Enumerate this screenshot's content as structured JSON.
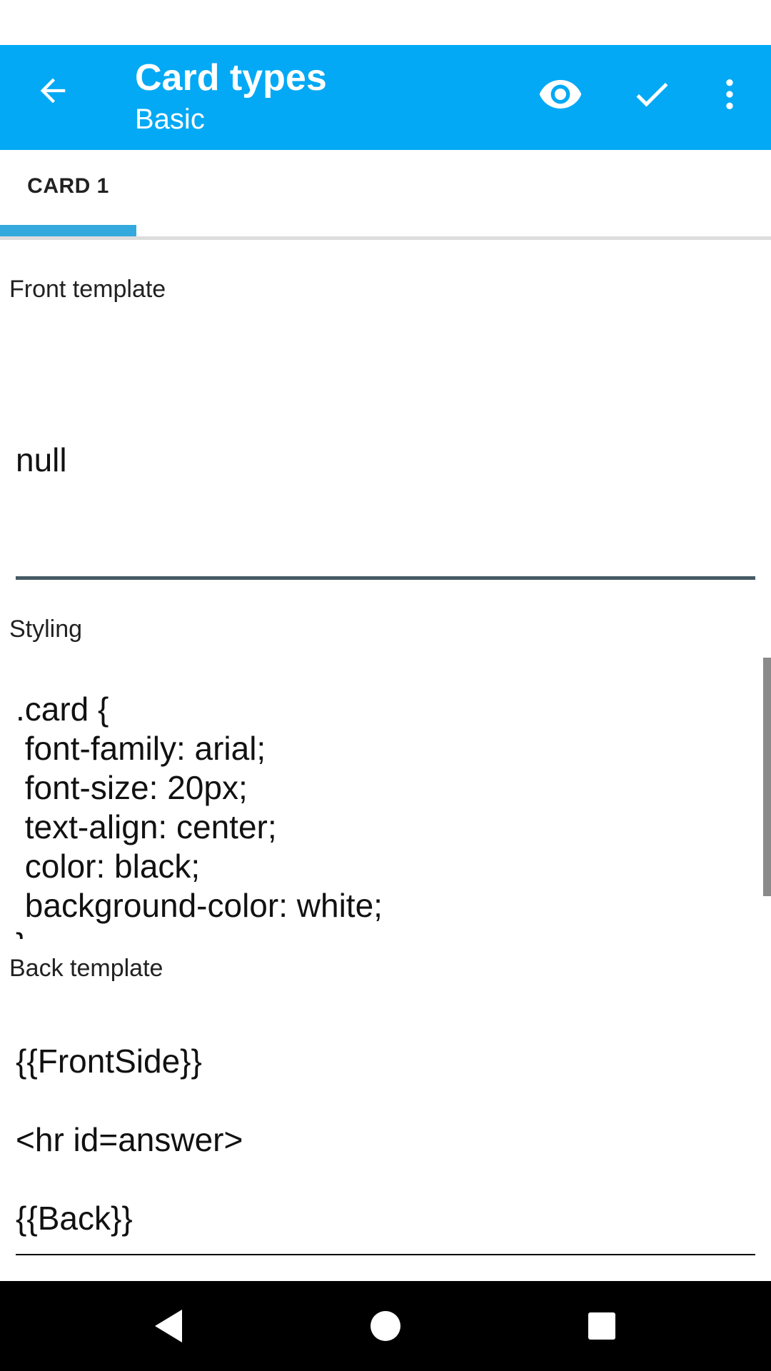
{
  "app_bar": {
    "title": "Card types",
    "subtitle": "Basic",
    "background_color": "#03a9f4",
    "icons": {
      "back": "arrow-left-icon",
      "preview": "eye-icon",
      "done": "check-icon",
      "more": "more-vertical-icon"
    }
  },
  "tabs": [
    {
      "label": "CARD 1",
      "selected": true
    }
  ],
  "front_template": {
    "label": "Front template",
    "lines": [
      "null"
    ]
  },
  "styling": {
    "label": "Styling",
    "lines": [
      ".card {",
      " font-family: arial;",
      " font-size: 20px;",
      " text-align: center;",
      " color: black;",
      " background-color: white;",
      "}"
    ]
  },
  "back_template": {
    "label": "Back template",
    "lines": [
      "{{FrontSide}}",
      "",
      "<hr id=answer>",
      "",
      "{{Back}}"
    ]
  },
  "nav_bar": {
    "icons": [
      "back-triangle-icon",
      "home-circle-icon",
      "recents-square-icon"
    ]
  }
}
